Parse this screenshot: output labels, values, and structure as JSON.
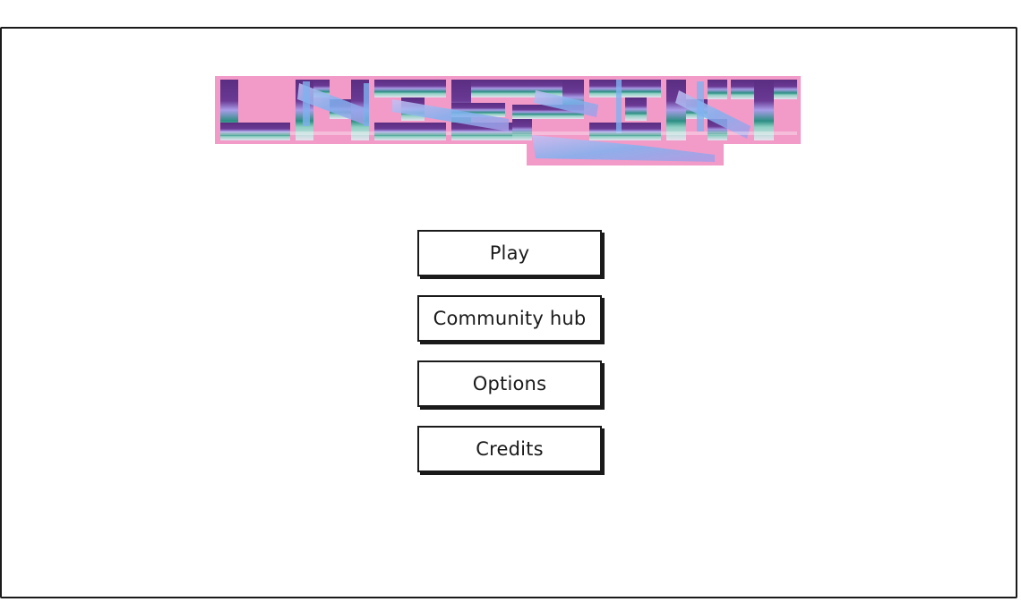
{
  "logo": {
    "text": "LAZERZEKT",
    "colors": {
      "outline": "#f29ac8",
      "top": "#5a2d82",
      "mid": "#a99de8",
      "teal": "#2d8f84",
      "light": "#d8d4f2",
      "accent": "#7fb2f0"
    }
  },
  "menu": {
    "items": [
      {
        "label": "Play"
      },
      {
        "label": "Community hub"
      },
      {
        "label": "Options"
      },
      {
        "label": "Credits"
      }
    ]
  },
  "icons": {
    "logo": "lazerzekt-logo"
  }
}
